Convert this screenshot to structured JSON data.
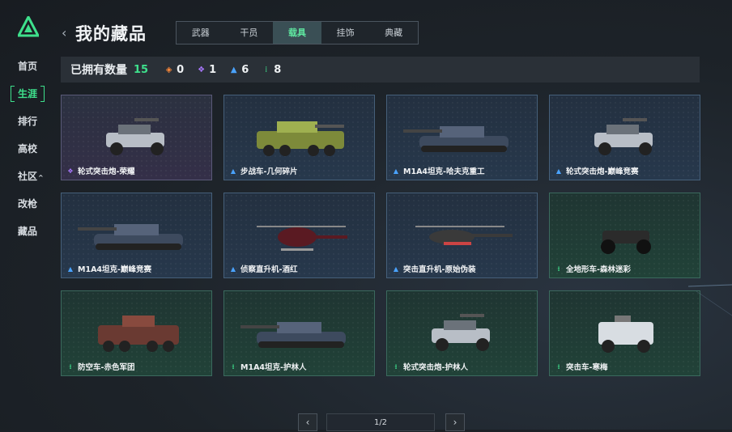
{
  "header": {
    "title": "我的藏品",
    "back_label": "‹"
  },
  "nav": {
    "items": [
      {
        "label": "首页"
      },
      {
        "label": "生涯"
      },
      {
        "label": "排行"
      },
      {
        "label": "高校"
      },
      {
        "label": "社区",
        "caret": "^"
      },
      {
        "label": "改枪"
      },
      {
        "label": "藏品"
      }
    ]
  },
  "tabs": [
    {
      "label": "武器"
    },
    {
      "label": "干员"
    },
    {
      "label": "载具"
    },
    {
      "label": "挂饰"
    },
    {
      "label": "典藏"
    }
  ],
  "active_tab": "载具",
  "active_nav": "生涯",
  "stats": {
    "owned_label": "已拥有数量",
    "owned_total": "15",
    "counts": [
      {
        "rarity": "orange",
        "icon": "diamond-orange-icon",
        "value": "0"
      },
      {
        "rarity": "purple",
        "icon": "diamond-purple-icon",
        "value": "1"
      },
      {
        "rarity": "blue",
        "icon": "triangle-blue-icon",
        "value": "6"
      },
      {
        "rarity": "green",
        "icon": "dots-green-icon",
        "value": "8"
      }
    ]
  },
  "collection": [
    {
      "name": "轮式突击炮-荣耀",
      "rarity": "purple",
      "vehicle": "buggy"
    },
    {
      "name": "步战车-几何碎片",
      "rarity": "blue",
      "vehicle": "ifv"
    },
    {
      "name": "M1A4坦克-哈夫克重工",
      "rarity": "blue",
      "vehicle": "tank"
    },
    {
      "name": "轮式突击炮-巅峰竞赛",
      "rarity": "blue",
      "vehicle": "buggy"
    },
    {
      "name": "M1A4坦克-巅峰竞赛",
      "rarity": "blue",
      "vehicle": "tank"
    },
    {
      "name": "侦察直升机-酒红",
      "rarity": "blue",
      "vehicle": "scout-heli"
    },
    {
      "name": "突击直升机-原始伪装",
      "rarity": "blue",
      "vehicle": "attack-heli"
    },
    {
      "name": "全地形车-森林迷彩",
      "rarity": "green",
      "vehicle": "atv"
    },
    {
      "name": "防空车-赤色军团",
      "rarity": "green",
      "vehicle": "aa-truck"
    },
    {
      "name": "M1A4坦克-护林人",
      "rarity": "green",
      "vehicle": "tank"
    },
    {
      "name": "轮式突击炮-护林人",
      "rarity": "green",
      "vehicle": "buggy"
    },
    {
      "name": "突击车-寒梅",
      "rarity": "green",
      "vehicle": "armored-car"
    }
  ],
  "pager": {
    "label": "1/2",
    "prev": "‹",
    "next": "›"
  },
  "colors": {
    "accent": "#3ee08c",
    "purple": "#a978ff",
    "blue": "#4aa3ff",
    "orange": "#ff8a3a"
  }
}
